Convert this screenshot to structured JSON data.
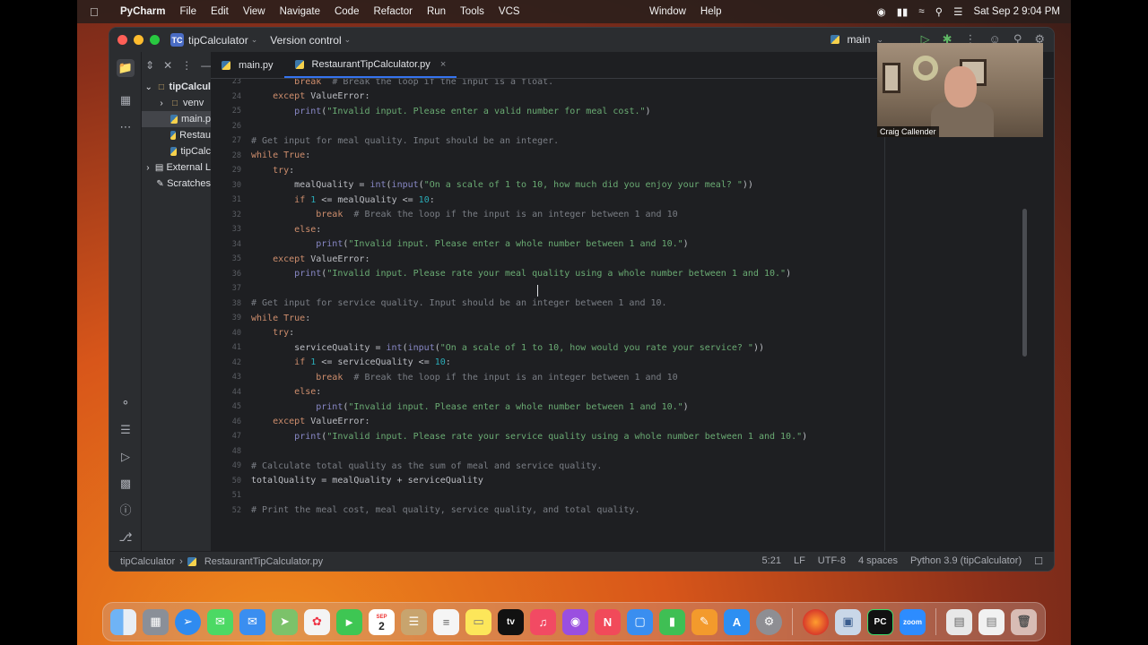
{
  "menubar": {
    "app": "PyCharm",
    "items": [
      "File",
      "Edit",
      "View",
      "Navigate",
      "Code",
      "Refactor",
      "Run",
      "Tools",
      "VCS"
    ],
    "center_items": [
      "Window",
      "Help"
    ],
    "datetime": "Sat Sep 2  9:04 PM"
  },
  "titlebar": {
    "project_badge": "TC",
    "project_name": "tipCalculator",
    "version_control": "Version control",
    "branch": "main"
  },
  "project_tree": [
    {
      "label": "tipCalcul",
      "kind": "root"
    },
    {
      "label": "venv",
      "kind": "folder"
    },
    {
      "label": "main.p",
      "kind": "py",
      "selected": true
    },
    {
      "label": "Restau",
      "kind": "py"
    },
    {
      "label": "tipCalc",
      "kind": "py"
    },
    {
      "label": "External L",
      "kind": "lib"
    },
    {
      "label": "Scratches",
      "kind": "scratch"
    }
  ],
  "tabs": [
    {
      "label": "main.py",
      "active": false
    },
    {
      "label": "RestaurantTipCalculator.py",
      "active": true
    }
  ],
  "code_lines": [
    {
      "n": "23",
      "html": "        <span class='kw'>break</span>  <span class='cm'># Break the loop if the input is a float.</span>"
    },
    {
      "n": "24",
      "html": "    <span class='kw'>except</span> ValueError:"
    },
    {
      "n": "25",
      "html": "        <span class='bi'>print</span>(<span class='st'>\"Invalid input. Please enter a valid number for meal cost.\"</span>)"
    },
    {
      "n": "26",
      "html": ""
    },
    {
      "n": "27",
      "html": "<span class='cm'># Get input for meal quality. Input should be an integer.</span>"
    },
    {
      "n": "28",
      "html": "<span class='kw'>while True</span>:"
    },
    {
      "n": "29",
      "html": "    <span class='kw'>try</span>:"
    },
    {
      "n": "30",
      "html": "        mealQuality = <span class='bi'>int</span>(<span class='bi'>input</span>(<span class='st'>\"On a scale of 1 to 10, how much did you enjoy your meal? \"</span>))"
    },
    {
      "n": "31",
      "html": "        <span class='kw'>if</span> <span class='nm'>1</span> &lt;= mealQuality &lt;= <span class='nm'>10</span>:"
    },
    {
      "n": "32",
      "html": "            <span class='kw'>break</span>  <span class='cm'># Break the loop if the input is an integer between 1 and 10</span>"
    },
    {
      "n": "33",
      "html": "        <span class='kw'>else</span>:"
    },
    {
      "n": "34",
      "html": "            <span class='bi'>print</span>(<span class='st'>\"Invalid input. Please enter a whole number between 1 and 10.\"</span>)"
    },
    {
      "n": "35",
      "html": "    <span class='kw'>except</span> ValueError:"
    },
    {
      "n": "36",
      "html": "        <span class='bi'>print</span>(<span class='st'>\"Invalid input. Please rate your meal quality using a whole number between 1 and 10.\"</span>)"
    },
    {
      "n": "37",
      "html": ""
    },
    {
      "n": "38",
      "html": "<span class='cm'># Get input for service quality. Input should be an integer between 1 and 10.</span>"
    },
    {
      "n": "39",
      "html": "<span class='kw'>while True</span>:"
    },
    {
      "n": "40",
      "html": "    <span class='kw'>try</span>:"
    },
    {
      "n": "41",
      "html": "        serviceQuality = <span class='bi'>int</span>(<span class='bi'>input</span>(<span class='st'>\"On a scale of 1 to 10, how would you rate your service? \"</span>))"
    },
    {
      "n": "42",
      "html": "        <span class='kw'>if</span> <span class='nm'>1</span> &lt;= serviceQuality &lt;= <span class='nm'>10</span>:"
    },
    {
      "n": "43",
      "html": "            <span class='kw'>break</span>  <span class='cm'># Break the loop if the input is an integer between 1 and 10</span>"
    },
    {
      "n": "44",
      "html": "        <span class='kw'>else</span>:"
    },
    {
      "n": "45",
      "html": "            <span class='bi'>print</span>(<span class='st'>\"Invalid input. Please enter a whole number between 1 and 10.\"</span>)"
    },
    {
      "n": "46",
      "html": "    <span class='kw'>except</span> ValueError:"
    },
    {
      "n": "47",
      "html": "        <span class='bi'>print</span>(<span class='st'>\"Invalid input. Please rate your service quality using a whole number between 1 and 10.\"</span>)"
    },
    {
      "n": "48",
      "html": ""
    },
    {
      "n": "49",
      "html": "<span class='cm'># Calculate total quality as the sum of meal and service quality.</span>"
    },
    {
      "n": "50",
      "html": "totalQuality = mealQuality + serviceQuality"
    },
    {
      "n": "51",
      "html": ""
    },
    {
      "n": "52",
      "html": "<span class='cm'># Print the meal cost, meal quality, service quality, and total quality.</span>"
    }
  ],
  "statusbar": {
    "project": "tipCalculator",
    "file": "RestaurantTipCalculator.py",
    "position": "5:21",
    "line_ending": "LF",
    "encoding": "UTF-8",
    "indent": "4 spaces",
    "interpreter": "Python 3.9 (tipCalculator)"
  },
  "webcam": {
    "name": "Craig Callender"
  },
  "dock_apps": [
    "Finder",
    "Launchpad",
    "Safari",
    "Messages",
    "Mail",
    "Maps",
    "Photos",
    "FaceTime",
    "Calendar",
    "Notes",
    "Reminders",
    "Notes",
    "TV",
    "Music",
    "Podcasts",
    "News",
    "Keynote",
    "Numbers",
    "Pages",
    "App Store",
    "System Settings",
    "Firefox",
    "Preview",
    "PyCharm",
    "Zoom",
    "Downloads",
    "Documents",
    "Trash"
  ],
  "calendar_day": "2",
  "calendar_month": "SEP",
  "colors": {
    "editor_bg": "#1e1f22",
    "panel_bg": "#2b2d30",
    "keyword": "#cf8e6d",
    "string": "#6aab73",
    "comment": "#7a7e85",
    "number": "#2aacb8",
    "accent": "#3574f0"
  }
}
